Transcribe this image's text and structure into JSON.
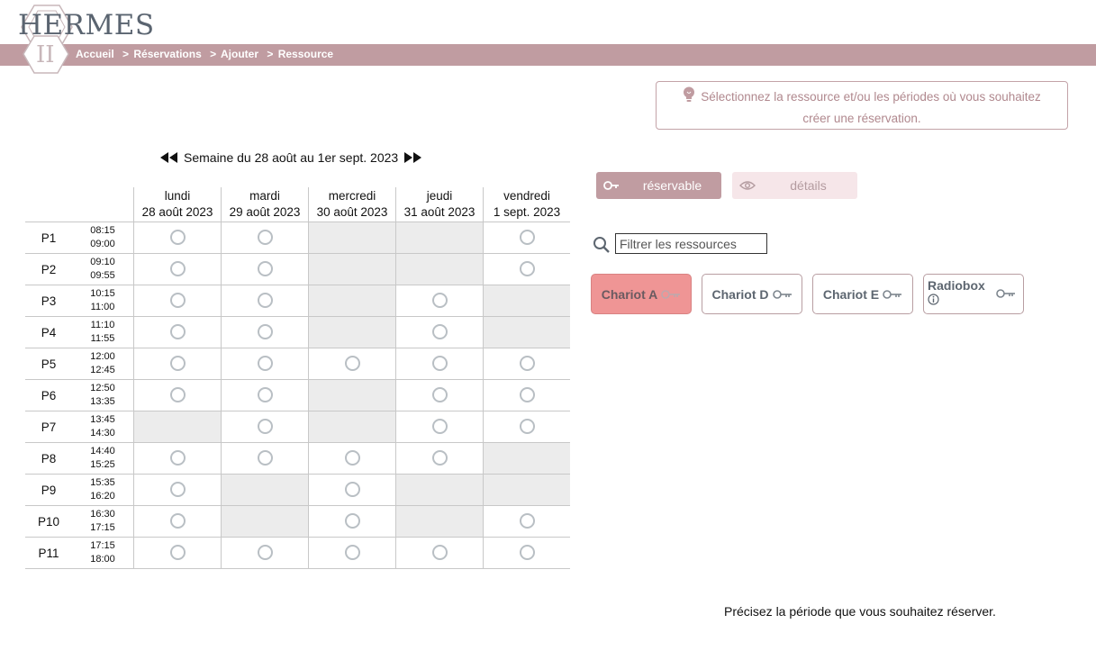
{
  "app": {
    "logo_text": "HERMES",
    "logo_sub": "II"
  },
  "breadcrumb": {
    "items": [
      "Accueil",
      "Réservations",
      "Ajouter",
      "Ressource"
    ],
    "separator": ">"
  },
  "hint": {
    "line1": "Sélectionnez la ressource et/ou les périodes où vous souhaitez",
    "line2": "créer une réservation.",
    "icon": "lightbulb-icon"
  },
  "week": {
    "label": "Semaine du 28 août au 1er sept. 2023",
    "prev_icon": "double-left-arrow-icon",
    "next_icon": "double-right-arrow-icon"
  },
  "days": [
    {
      "name": "lundi",
      "date": "28 août 2023"
    },
    {
      "name": "mardi",
      "date": "29 août 2023"
    },
    {
      "name": "mercredi",
      "date": "30 août 2023"
    },
    {
      "name": "jeudi",
      "date": "31 août 2023"
    },
    {
      "name": "vendredi",
      "date": "1 sept. 2023"
    }
  ],
  "periods": [
    {
      "name": "P1",
      "start": "08:15",
      "end": "09:00",
      "avail": [
        true,
        true,
        false,
        false,
        true
      ]
    },
    {
      "name": "P2",
      "start": "09:10",
      "end": "09:55",
      "avail": [
        true,
        true,
        false,
        false,
        true
      ]
    },
    {
      "name": "P3",
      "start": "10:15",
      "end": "11:00",
      "avail": [
        true,
        true,
        false,
        true,
        false
      ]
    },
    {
      "name": "P4",
      "start": "11:10",
      "end": "11:55",
      "avail": [
        true,
        true,
        false,
        true,
        false
      ]
    },
    {
      "name": "P5",
      "start": "12:00",
      "end": "12:45",
      "avail": [
        true,
        true,
        true,
        true,
        true
      ]
    },
    {
      "name": "P6",
      "start": "12:50",
      "end": "13:35",
      "avail": [
        true,
        true,
        false,
        true,
        true
      ]
    },
    {
      "name": "P7",
      "start": "13:45",
      "end": "14:30",
      "avail": [
        false,
        true,
        false,
        true,
        true
      ]
    },
    {
      "name": "P8",
      "start": "14:40",
      "end": "15:25",
      "avail": [
        true,
        true,
        true,
        true,
        false
      ]
    },
    {
      "name": "P9",
      "start": "15:35",
      "end": "16:20",
      "avail": [
        true,
        false,
        true,
        false,
        false
      ]
    },
    {
      "name": "P10",
      "start": "16:30",
      "end": "17:15",
      "avail": [
        true,
        false,
        true,
        false,
        true
      ]
    },
    {
      "name": "P11",
      "start": "17:15",
      "end": "18:00",
      "avail": [
        true,
        true,
        true,
        true,
        true
      ]
    }
  ],
  "toggles": {
    "reservable": "réservable",
    "details": "détails"
  },
  "filter": {
    "placeholder": "Filtrer les ressources",
    "value": ""
  },
  "resources": [
    {
      "name": "Chariot A",
      "selected": true
    },
    {
      "name": "Chariot D",
      "selected": false
    },
    {
      "name": "Chariot E",
      "selected": false
    },
    {
      "name": "Radiobox",
      "selected": false,
      "info": true
    }
  ],
  "footer": {
    "text": "Précisez la période que vous souhaitez réserver."
  },
  "colors": {
    "accent": "#c09ca1",
    "selected_resource": "#ef9595",
    "disabled_cell": "#ececec",
    "hint_text": "#b0888e"
  }
}
